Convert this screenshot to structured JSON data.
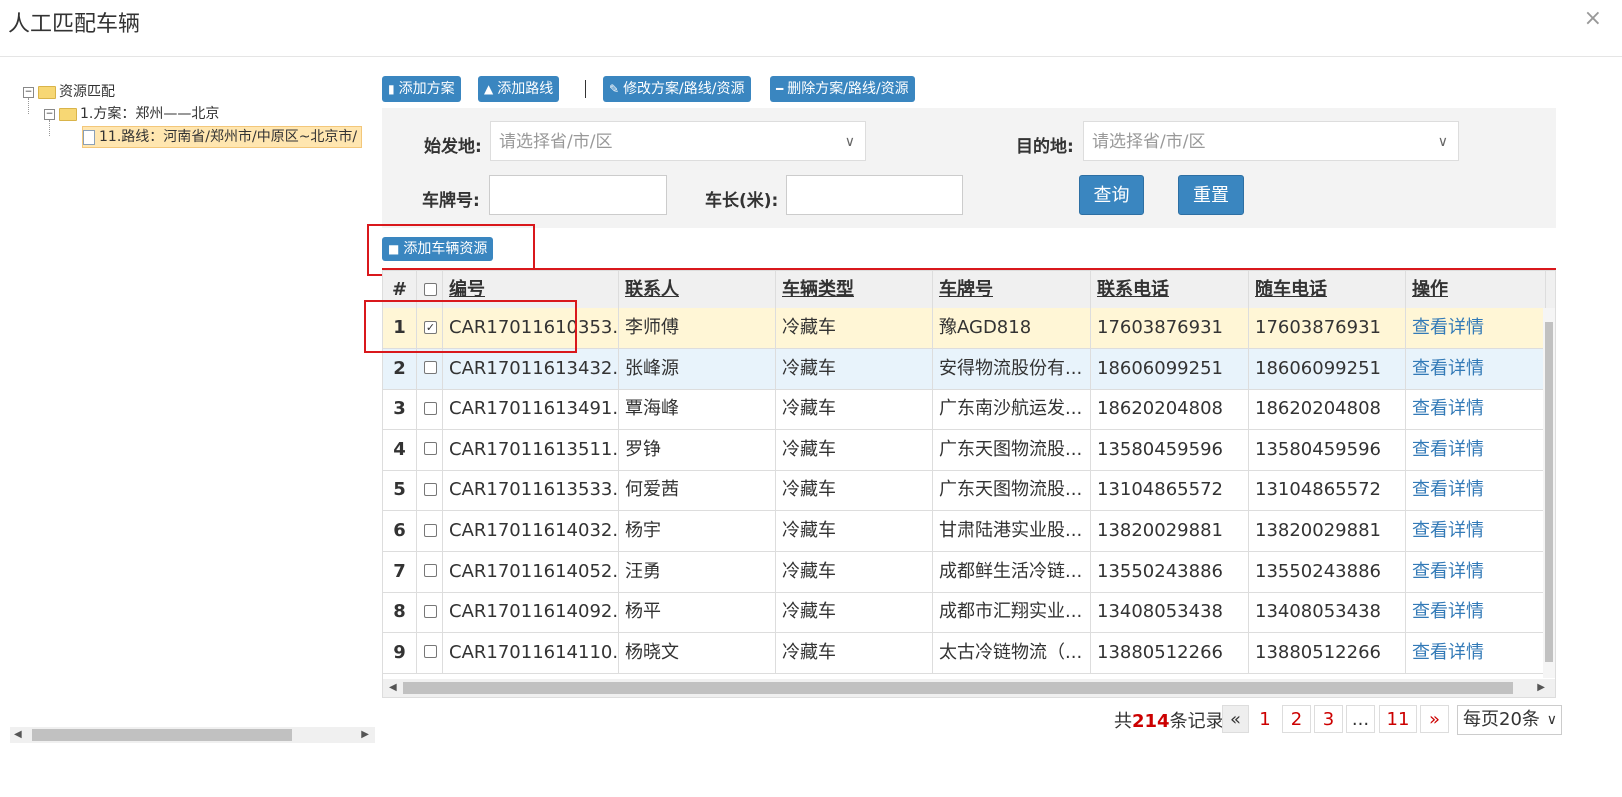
{
  "dialog": {
    "title": "人工匹配车辆",
    "close": "×"
  },
  "tree": {
    "root": "资源匹配",
    "plan": "1.方案：郑州——北京",
    "route": "11.路线：河南省/郑州市/中原区~北京市/",
    "expand_symbol": "−"
  },
  "toolbar": {
    "add_plan": "添加方案",
    "add_route": "添加路线",
    "edit": "修改方案/路线/资源",
    "delete": "删除方案/路线/资源"
  },
  "filter": {
    "origin_label": "始发地:",
    "origin_placeholder": "请选择省/市/区",
    "dest_label": "目的地:",
    "dest_placeholder": "请选择省/市/区",
    "plate_label": "车牌号:",
    "length_label": "车长(米):",
    "query": "查询",
    "reset": "重置"
  },
  "add_vehicle": "添加车辆资源",
  "table": {
    "headers": [
      "#",
      "编号",
      "联系人",
      "车辆类型",
      "车牌号",
      "联系电话",
      "随车电话",
      "操作"
    ],
    "rows": [
      {
        "n": "1",
        "id": "CAR17011610353...",
        "contact": "李师傅",
        "type": "冷藏车",
        "plate": "豫AGD818",
        "phone": "17603876931",
        "car_phone": "17603876931",
        "action": "查看详情",
        "checked": true
      },
      {
        "n": "2",
        "id": "CAR17011613432...",
        "contact": "张峰源",
        "type": "冷藏车",
        "plate": "安得物流股份有...",
        "phone": "18606099251",
        "car_phone": "18606099251",
        "action": "查看详情",
        "checked": false
      },
      {
        "n": "3",
        "id": "CAR17011613491...",
        "contact": "覃海峰",
        "type": "冷藏车",
        "plate": "广东南沙航运发...",
        "phone": "18620204808",
        "car_phone": "18620204808",
        "action": "查看详情",
        "checked": false
      },
      {
        "n": "4",
        "id": "CAR17011613511...",
        "contact": "罗铮",
        "type": "冷藏车",
        "plate": "广东天图物流股...",
        "phone": "13580459596",
        "car_phone": "13580459596",
        "action": "查看详情",
        "checked": false
      },
      {
        "n": "5",
        "id": "CAR17011613533...",
        "contact": "何爱茜",
        "type": "冷藏车",
        "plate": "广东天图物流股...",
        "phone": "13104865572",
        "car_phone": "13104865572",
        "action": "查看详情",
        "checked": false
      },
      {
        "n": "6",
        "id": "CAR17011614032...",
        "contact": "杨宇",
        "type": "冷藏车",
        "plate": "甘肃陆港实业股...",
        "phone": "13820029881",
        "car_phone": "13820029881",
        "action": "查看详情",
        "checked": false
      },
      {
        "n": "7",
        "id": "CAR17011614052...",
        "contact": "汪勇",
        "type": "冷藏车",
        "plate": "成都鲜生活冷链...",
        "phone": "13550243886",
        "car_phone": "13550243886",
        "action": "查看详情",
        "checked": false
      },
      {
        "n": "8",
        "id": "CAR17011614092...",
        "contact": "杨平",
        "type": "冷藏车",
        "plate": "成都市汇翔实业...",
        "phone": "13408053438",
        "car_phone": "13408053438",
        "action": "查看详情",
        "checked": false
      },
      {
        "n": "9",
        "id": "CAR17011614110...",
        "contact": "杨晓文",
        "type": "冷藏车",
        "plate": "太古冷链物流（...",
        "phone": "13880512266",
        "car_phone": "13880512266",
        "action": "查看详情",
        "checked": false
      }
    ]
  },
  "pager": {
    "total_prefix": "共",
    "total": "214",
    "total_suffix": "条记录",
    "prev": "«",
    "pages": [
      "1",
      "2",
      "3",
      "...",
      "11"
    ],
    "next": "»",
    "per_page": "每页20条",
    "per_page_chevron": "∨"
  },
  "colors": {
    "accent": "#3a86c0",
    "highlight": "#d9181c",
    "selected_row": "#fff6d6",
    "hover_row": "#e8f3fb"
  }
}
